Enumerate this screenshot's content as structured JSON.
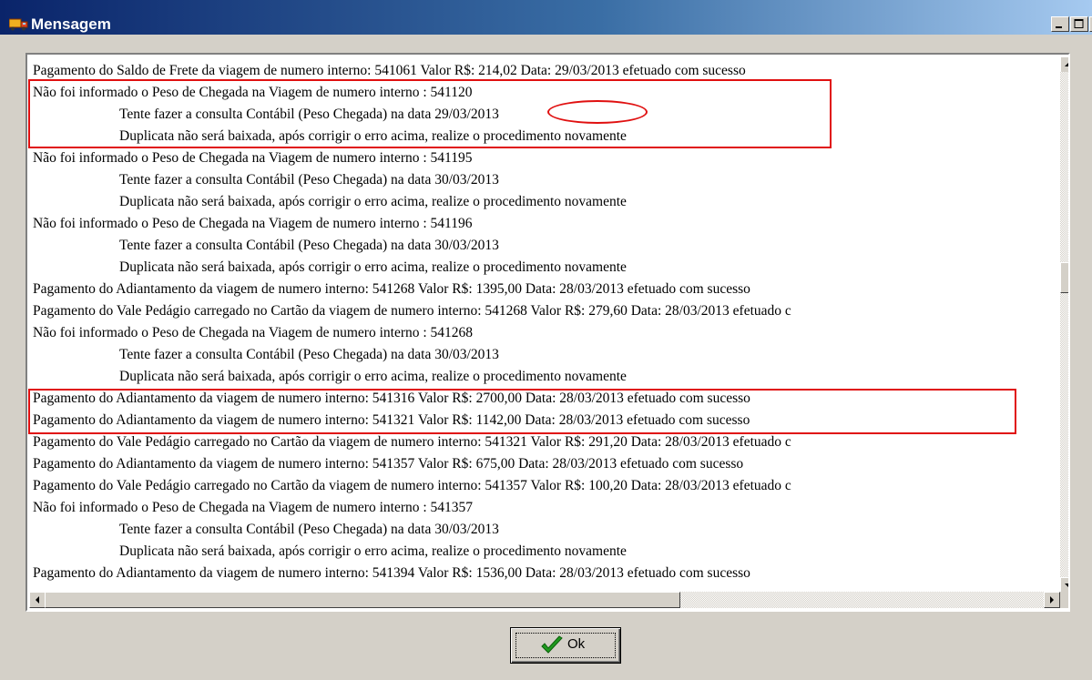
{
  "window": {
    "title": "Mensagem",
    "icon": "app-truck-icon",
    "controls": [
      "minimize-icon",
      "maximize-icon",
      "close-icon"
    ]
  },
  "messages": [
    {
      "text": "Pagamento do Saldo de Frete da viagem de numero interno: 541061 Valor R$: 214,02 Data: 29/03/2013 efetuado com sucesso",
      "indent": false
    },
    {
      "text": "Não foi informado o Peso de Chegada na Viagem de numero interno : 541120",
      "indent": false
    },
    {
      "text": "Tente fazer a consulta Contábil (Peso Chegada) na data 29/03/2013",
      "indent": true
    },
    {
      "text": "Duplicata não será baixada, após corrigir o erro acima, realize o procedimento novamente",
      "indent": true
    },
    {
      "text": "Não foi informado o Peso de Chegada na Viagem de numero interno : 541195",
      "indent": false
    },
    {
      "text": "Tente fazer a consulta Contábil (Peso Chegada) na data 30/03/2013",
      "indent": true
    },
    {
      "text": "Duplicata não será baixada, após corrigir o erro acima, realize o procedimento novamente",
      "indent": true
    },
    {
      "text": "Não foi informado o Peso de Chegada na Viagem de numero interno : 541196",
      "indent": false
    },
    {
      "text": "Tente fazer a consulta Contábil (Peso Chegada) na data 30/03/2013",
      "indent": true
    },
    {
      "text": "Duplicata não será baixada, após corrigir o erro acima, realize o procedimento novamente",
      "indent": true
    },
    {
      "text": "Pagamento do Adiantamento da viagem de numero interno: 541268 Valor R$: 1395,00 Data: 28/03/2013 efetuado com sucesso",
      "indent": false
    },
    {
      "text": "Pagamento do Vale Pedágio carregado no Cartão da viagem de numero interno: 541268 Valor R$: 279,60 Data: 28/03/2013 efetuado c",
      "indent": false
    },
    {
      "text": "Não foi informado o Peso de Chegada na Viagem de numero interno : 541268",
      "indent": false
    },
    {
      "text": "Tente fazer a consulta Contábil (Peso Chegada) na data 30/03/2013",
      "indent": true
    },
    {
      "text": "Duplicata não será baixada, após corrigir o erro acima, realize o procedimento novamente",
      "indent": true
    },
    {
      "text": "Pagamento do Adiantamento da viagem de numero interno: 541316 Valor R$: 2700,00 Data: 28/03/2013 efetuado com sucesso",
      "indent": false
    },
    {
      "text": "Pagamento do Adiantamento da viagem de numero interno: 541321 Valor R$: 1142,00 Data: 28/03/2013 efetuado com sucesso",
      "indent": false
    },
    {
      "text": "Pagamento do Vale Pedágio carregado no Cartão da viagem de numero interno: 541321 Valor R$: 291,20 Data: 28/03/2013 efetuado c",
      "indent": false
    },
    {
      "text": "Pagamento do Adiantamento da viagem de numero interno: 541357 Valor R$: 675,00 Data: 28/03/2013 efetuado com sucesso",
      "indent": false
    },
    {
      "text": "Pagamento do Vale Pedágio carregado no Cartão da viagem de numero interno: 541357 Valor R$: 100,20 Data: 28/03/2013 efetuado c",
      "indent": false
    },
    {
      "text": "Não foi informado o Peso de Chegada na Viagem de numero interno : 541357",
      "indent": false
    },
    {
      "text": "Tente fazer a consulta Contábil (Peso Chegada) na data 30/03/2013",
      "indent": true
    },
    {
      "text": "Duplicata não será baixada, após corrigir o erro acima, realize o procedimento novamente",
      "indent": true
    },
    {
      "text": "Pagamento do Adiantamento da viagem de numero interno: 541394 Valor R$: 1536,00 Data: 28/03/2013 efetuado com sucesso",
      "indent": false
    }
  ],
  "ok_button": {
    "label": "Ok",
    "icon": "checkmark-icon"
  },
  "colors": {
    "highlight": "#e01010",
    "titlebar_start": "#0a246a",
    "titlebar_end": "#a6caf0",
    "face": "#d4d0c8"
  }
}
